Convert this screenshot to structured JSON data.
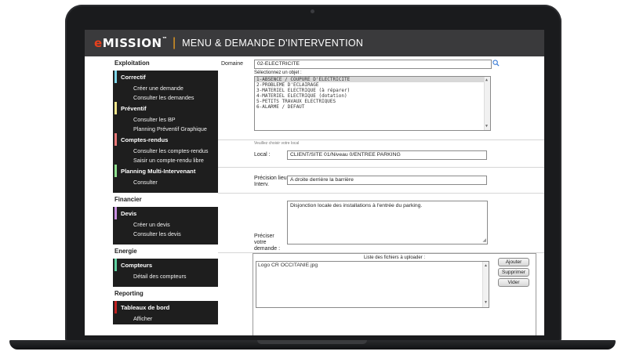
{
  "header": {
    "logo_e": "e",
    "logo_rest": "MISSION",
    "logo_tm": "™",
    "separator": "|",
    "title": "MENU & DEMANDE D'INTERVENTION"
  },
  "sidebar": {
    "sections": [
      {
        "title": "Exploitation"
      },
      {
        "title": "Financier"
      },
      {
        "title": "Energie"
      },
      {
        "title": "Reporting"
      }
    ],
    "categories": {
      "correctif": {
        "label": "Correctif",
        "color": "#7fd7ea",
        "links": [
          "Créer une demande",
          "Consulter les demandes"
        ]
      },
      "preventif": {
        "label": "Préventif",
        "color": "#f0e68c",
        "links": [
          "Consulter les BP",
          "Planning Préventif Graphique"
        ]
      },
      "comptes_rendus": {
        "label": "Comptes-rendus",
        "color": "#e87878",
        "links": [
          "Consulter les comptes-rendus",
          "Saisir un compte-rendu libre"
        ]
      },
      "planning_multi": {
        "label": "Planning Multi-Intervenant",
        "color": "#8fe08f",
        "links": [
          "Consulter"
        ]
      },
      "devis": {
        "label": "Devis",
        "color": "#c890e0",
        "links": [
          "Créer un devis",
          "Consulter les devis"
        ]
      },
      "compteurs": {
        "label": "Compteurs",
        "color": "#5fd0a0",
        "links": [
          "Détail des compteurs"
        ]
      },
      "tableaux": {
        "label": "Tableaux de bord",
        "color": "#c02020",
        "links": [
          "Afficher"
        ]
      }
    }
  },
  "form": {
    "domaine_label": "Domaine",
    "domaine_value": "02-ELECTRICITE",
    "objet_caption": "Sélectionnez un objet :",
    "objet_options": [
      "1-ABSENCE / COUPURE D'ELECTRICITE",
      "2-PROBLEME D'ECLAIRAGE",
      "3-MATERIEL ELECTRIQUE (à réparer)",
      "4-MATERIEL ELECTRIQUE (dotation)",
      "5-PETITS TRAVAUX ELECTRIQUES",
      "6-ALARME / DEFAUT"
    ],
    "local_hint": "Veuillez choisir votre local",
    "local_label": "Local :",
    "local_value": "CLIENT/SITE 01/Niveau 0/ENTREE PARKING",
    "precision_label_1": "Précision lieu",
    "precision_label_2": "Interv.",
    "precision_value": "A droite derrière la barrière",
    "preciser_label_1": "Préciser",
    "preciser_label_2": "votre",
    "preciser_label_3": "demande :",
    "demande_value": "Disjonction locale des installations à l'entrée du parking.",
    "files_caption": "Liste des fichiers à uploader :",
    "files": [
      "Logo CR OCCITANIE.jpg"
    ],
    "btn_add": "Ajouter",
    "btn_delete": "Supprimer",
    "btn_clear": "Vider"
  },
  "colors": {
    "header_bg": "#3a3a3c",
    "logo_accent": "#e8401c",
    "separator": "#f0a020",
    "sidebar_block": "#1e1e1e"
  }
}
